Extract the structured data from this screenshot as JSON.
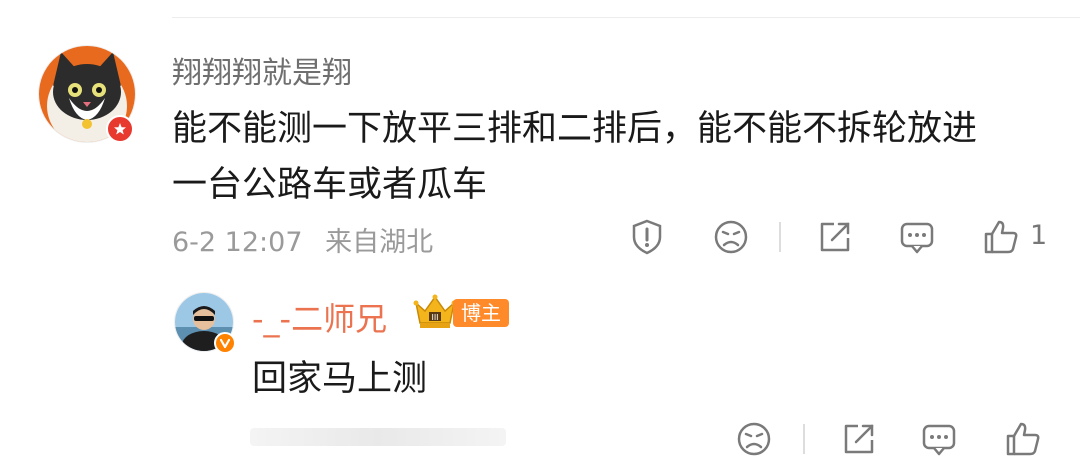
{
  "comment": {
    "username": "翔翔翔就是翔",
    "text_line1": "能不能测一下放平三排和二排后，能不能不拆轮放进",
    "text_line2": "一台公路车或者瓜车",
    "date": "6-2 12:07",
    "location": "来自湖北",
    "like_count": "1"
  },
  "reply": {
    "username": "-_-二师兄",
    "badge_label": "博主",
    "text": "回家马上测"
  },
  "colors": {
    "username_gray": "#6f6f6f",
    "reply_name_orange": "#eb7350",
    "host_badge": "#ff8a2a",
    "avatar_badge_red": "#e8392f",
    "verified_orange": "#ff8200",
    "icon_gray": "#7a7a7a"
  },
  "icons": [
    "report-icon",
    "dislike-icon",
    "share-icon",
    "comment-icon",
    "like-icon",
    "crown-icon"
  ]
}
